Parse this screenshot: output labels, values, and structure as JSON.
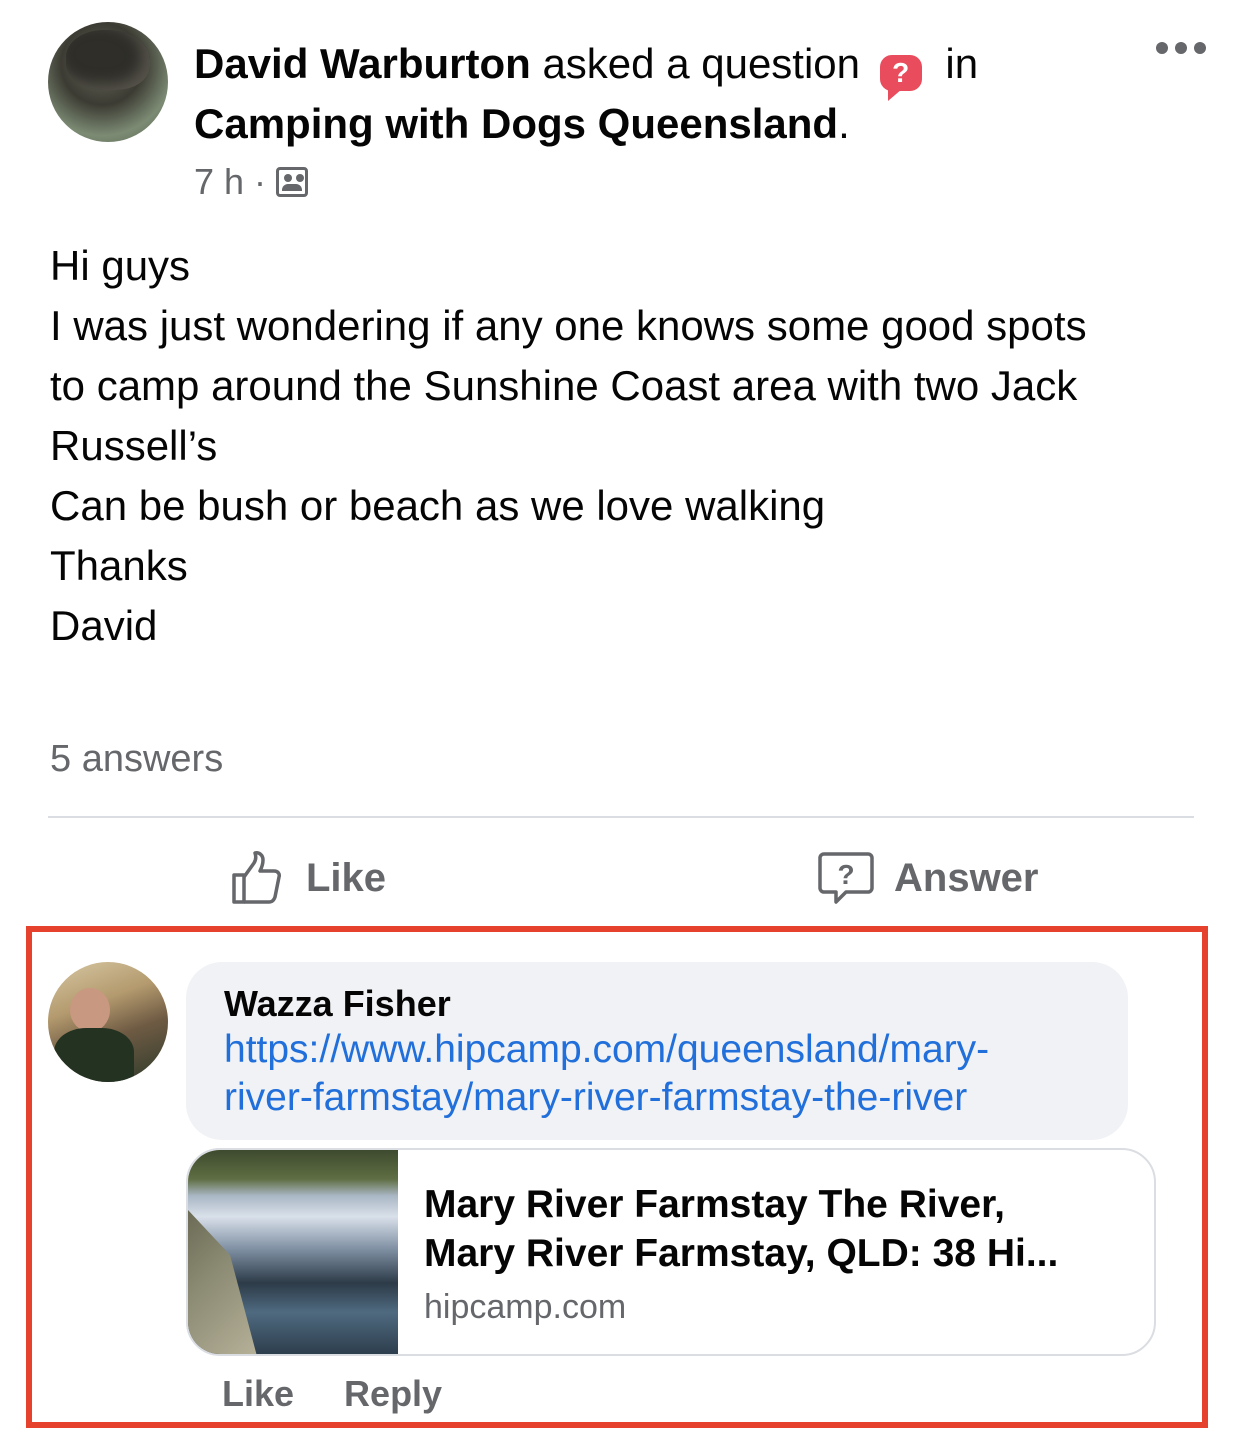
{
  "post": {
    "author": "David Warburton",
    "action_text": "asked a question",
    "question_badge": "?",
    "in_text": "in",
    "group": "Camping with Dogs Queensland",
    "group_suffix": ".",
    "time": "7 h",
    "separator": "·",
    "audience_icon": "group-icon",
    "more_icon": "more-options-icon",
    "body_lines": [
      "Hi guys",
      "I was just wondering if any one knows some good spots",
      "to camp around the Sunshine Coast area with two Jack",
      "Russell’s",
      "Can be bush or beach as we love walking",
      "Thanks",
      "David"
    ],
    "answers_count": "5 answers"
  },
  "actions": {
    "like_label": "Like",
    "answer_label": "Answer",
    "like_icon": "thumbs-up-icon",
    "answer_icon": "question-bubble-icon"
  },
  "comment": {
    "author": "Wazza Fisher",
    "link_lines": [
      "https://www.hipcamp.com/queensland/mary-",
      "river-farmstay/mary-river-farmstay-the-river"
    ],
    "preview": {
      "title_lines": [
        "Mary River Farmstay The River,",
        "Mary River Farmstay, QLD: 38 Hi..."
      ],
      "domain": "hipcamp.com"
    },
    "like_label": "Like",
    "reply_label": "Reply"
  },
  "colors": {
    "highlight": "#e5412d",
    "link": "#216fdb",
    "question_badge": "#e94c5d",
    "secondary_text": "#65676b",
    "bubble_bg": "#f0f2f5"
  }
}
